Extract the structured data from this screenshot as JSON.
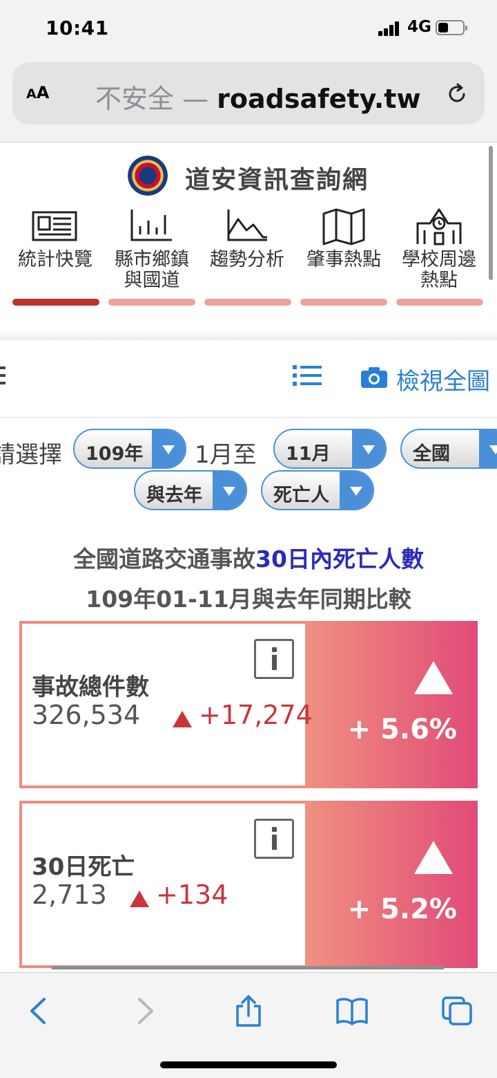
{
  "status_bar": {
    "time": "10:41",
    "network": "4G"
  },
  "browser": {
    "aa_label_small": "A",
    "aa_label_large": "A",
    "url_insecure": "不安全 — ",
    "url_domain": "roadsafety.tw"
  },
  "site": {
    "title": "道安資訊查詢網",
    "nav": [
      {
        "label": "統計快覽",
        "icon": "newspaper-icon",
        "active": true
      },
      {
        "label": "縣市鄉鎮\n與國道",
        "icon": "bar-chart-icon",
        "active": false
      },
      {
        "label": "趨勢分析",
        "icon": "area-chart-icon",
        "active": false
      },
      {
        "label": "肇事熱點",
        "icon": "map-icon",
        "active": false
      },
      {
        "label": "學校周邊\n熱點",
        "icon": "school-icon",
        "active": false
      }
    ]
  },
  "toolbar": {
    "view_full_label": "檢視全圖"
  },
  "selector": {
    "prompt": "請選擇",
    "year": "109年",
    "month_start_text": "1月至",
    "month_end": "11月",
    "region": "全國",
    "compare": "與去年",
    "metric": "死亡人"
  },
  "headline": {
    "line1_prefix": "全國道路交通事故",
    "line1_highlight": "30日內死亡人數",
    "line2": "109年01-11月與去年同期比較"
  },
  "cards": [
    {
      "title": "事故總件數",
      "count": "326,534",
      "delta": "+17,274",
      "percent": "+ 5.6%"
    },
    {
      "title": "30日死亡",
      "count": "2,713",
      "delta": "+134",
      "percent": "+ 5.2%"
    }
  ],
  "colors": {
    "accent_blue": "#2a7fd4",
    "headline_blue": "#2b2bb8",
    "increase_red": "#c8363c",
    "card_border": "#f08a80",
    "active_tab": "#c0302a"
  }
}
